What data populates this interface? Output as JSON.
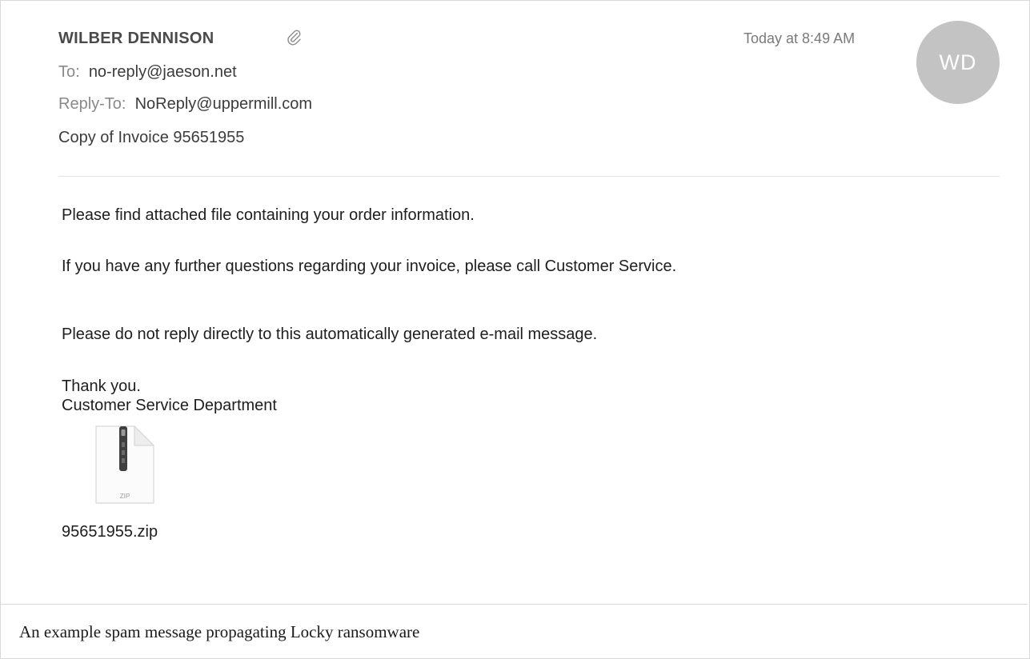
{
  "message": {
    "sender": "WILBER DENNISON",
    "date": "Today at 8:49 AM",
    "avatar_initials": "WD",
    "to_label": "To:",
    "to_value": "no-reply@jaeson.net",
    "reply_to_label": "Reply-To:",
    "reply_to_value": "NoReply@uppermill.com",
    "subject": "Copy of Invoice 95651955",
    "body": [
      "Please find attached file containing your order information.",
      "If you have any further questions regarding your invoice, please call Customer Service.",
      "Please do not reply directly to this automatically generated e-mail message.",
      "Thank you.",
      "Customer Service Department"
    ],
    "attachment": {
      "icon": "zip-file-icon",
      "type_label": "ZIP",
      "filename": "95651955.zip"
    }
  },
  "caption": "An example spam message propagating Locky ransomware",
  "colors": {
    "avatar_bg": "#c3c3c3",
    "label_gray": "#8a8a8a",
    "text_dark": "#1e1e1e"
  }
}
